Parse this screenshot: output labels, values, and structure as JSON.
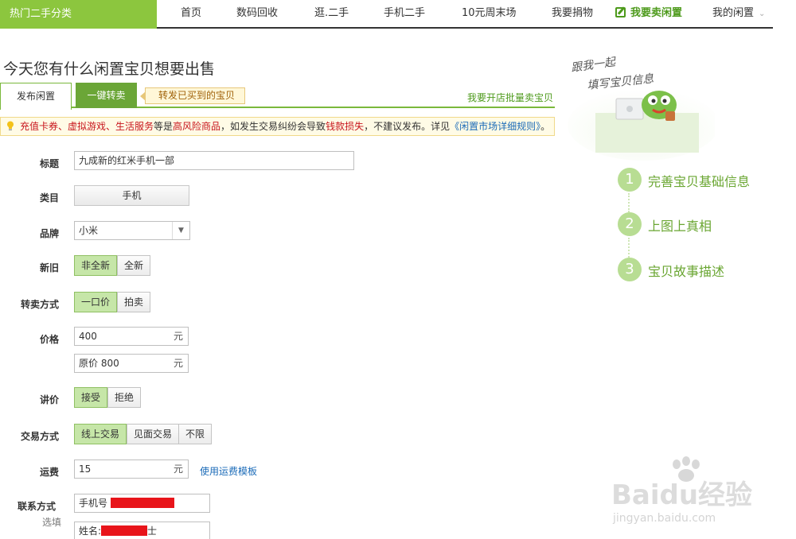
{
  "hot_category": "热门二手分类",
  "nav": {
    "items": [
      "首页",
      "数码回收",
      "逛.二手",
      "手机二手",
      "10元周末场",
      "我要捐物",
      "我要卖闲置",
      "我的闲置"
    ],
    "active_index": 6
  },
  "page_title": "今天您有什么闲置宝贝想要出售",
  "tabs": {
    "publish": "发布闲置",
    "forward": "一键转卖",
    "forward_tip": "转发已买到的宝贝",
    "batch_link": "我要开店批量卖宝贝"
  },
  "warning": {
    "items": "充值卡券、虚拟游戏、生活服务",
    "t1": "等是",
    "risk": "高风险商品",
    "t2": "，如发生交易纠纷会导致",
    "loss": "钱款损失",
    "t3": "，不建议发布。详见",
    "link": "《闲置市场详细规则》",
    "t4": "。"
  },
  "form": {
    "title_label": "标题",
    "title_value": "九成新的红米手机一部",
    "category_label": "类目",
    "category_value": "手机",
    "brand_label": "品牌",
    "brand_value": "小米",
    "condition_label": "新旧",
    "condition_options": [
      "非全新",
      "全新"
    ],
    "condition_selected": 0,
    "sale_label": "转卖方式",
    "sale_options": [
      "一口价",
      "拍卖"
    ],
    "sale_selected": 0,
    "price_label": "价格",
    "price_value": "400",
    "price_unit": "元",
    "orig_prefix": "原价",
    "orig_value": "800",
    "orig_unit": "元",
    "bargain_label": "讲价",
    "bargain_options": [
      "接受",
      "拒绝"
    ],
    "bargain_selected": 0,
    "trade_label": "交易方式",
    "trade_options": [
      "线上交易",
      "见面交易",
      "不限"
    ],
    "trade_selected": 0,
    "shipping_label": "运费",
    "shipping_value": "15",
    "shipping_unit": "元",
    "shipping_template_link": "使用运费模板",
    "contact_label": "联系方式",
    "optional_label": "选填",
    "phone_prefix": "手机号",
    "name_prefix": "姓名:",
    "name_suffix": "士"
  },
  "steps": [
    {
      "num": "1",
      "text": "完善宝贝基础信息"
    },
    {
      "num": "2",
      "text": "上图上真相"
    },
    {
      "num": "3",
      "text": "宝贝故事描述"
    }
  ],
  "mascot_caption": [
    "跟我一起",
    "填写宝贝信息"
  ],
  "watermark": {
    "brand": "Baidu经验",
    "url": "jingyan.baidu.com"
  },
  "colors": {
    "green": "#8cc63e",
    "dark_green": "#4d9a1b",
    "red": "#c8161d",
    "link": "#1b6bb8"
  }
}
